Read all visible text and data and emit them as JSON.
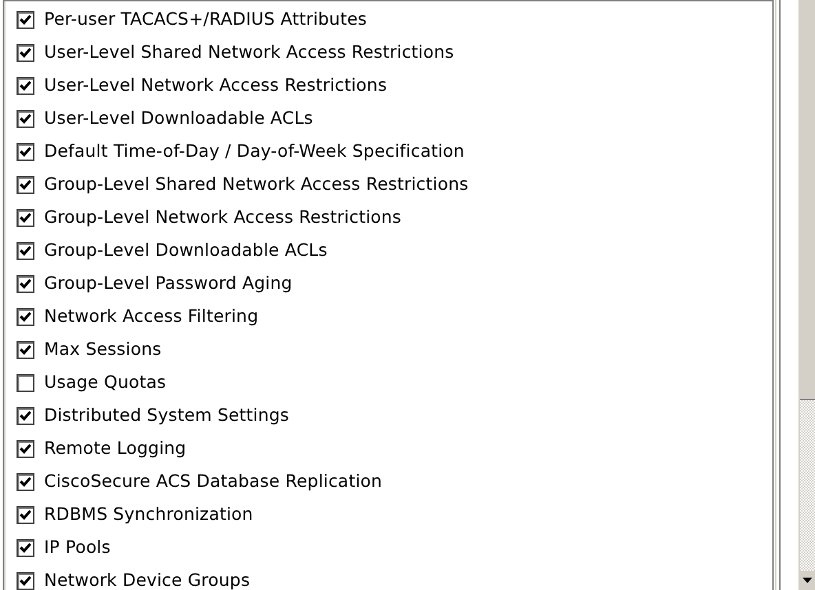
{
  "options": [
    {
      "label": "Per-user TACACS+/RADIUS Attributes",
      "checked": true
    },
    {
      "label": "User-Level Shared Network Access Restrictions",
      "checked": true
    },
    {
      "label": "User-Level Network Access Restrictions",
      "checked": true
    },
    {
      "label": "User-Level Downloadable ACLs",
      "checked": true
    },
    {
      "label": "Default Time-of-Day / Day-of-Week Specification",
      "checked": true
    },
    {
      "label": "Group-Level Shared Network Access Restrictions",
      "checked": true
    },
    {
      "label": "Group-Level Network Access Restrictions",
      "checked": true
    },
    {
      "label": "Group-Level Downloadable ACLs",
      "checked": true
    },
    {
      "label": "Group-Level Password Aging",
      "checked": true
    },
    {
      "label": "Network Access Filtering",
      "checked": true
    },
    {
      "label": "Max Sessions",
      "checked": true
    },
    {
      "label": "Usage Quotas",
      "checked": false
    },
    {
      "label": "Distributed System Settings",
      "checked": true
    },
    {
      "label": "Remote Logging",
      "checked": true
    },
    {
      "label": "CiscoSecure ACS Database Replication",
      "checked": true
    },
    {
      "label": "RDBMS Synchronization",
      "checked": true
    },
    {
      "label": "IP Pools",
      "checked": true
    },
    {
      "label": "Network Device Groups",
      "checked": true
    }
  ]
}
